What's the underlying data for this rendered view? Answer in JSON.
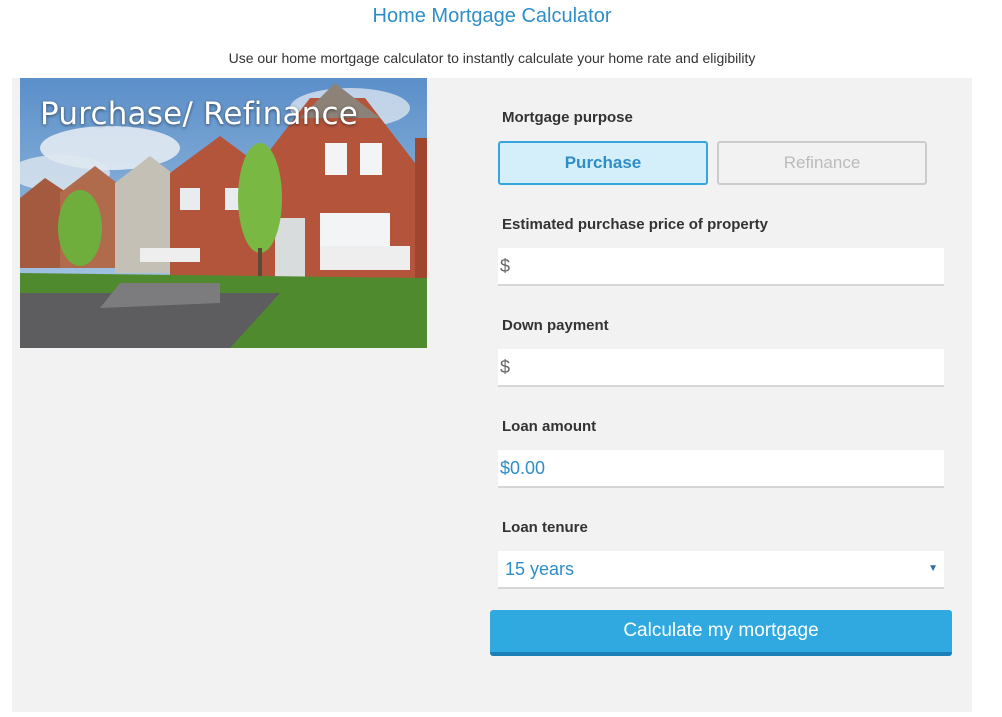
{
  "header": {
    "title": "Home Mortgage Calculator",
    "subtitle": "Use our home mortgage calculator to instantly calculate your home rate and eligibility"
  },
  "hero": {
    "caption": "Purchase/ Refinance"
  },
  "form": {
    "purpose_label": "Mortgage purpose",
    "purpose_options": [
      "Purchase",
      "Refinance"
    ],
    "purpose_selected": "Purchase",
    "price_label": "Estimated purchase price of property",
    "price_prefix": "$",
    "price_value": "",
    "down_label": "Down payment",
    "down_prefix": "$",
    "down_value": "",
    "loan_label": "Loan amount",
    "loan_value": "$0.00",
    "tenure_label": "Loan tenure",
    "tenure_value": "15 years",
    "tenure_arrow": "▼",
    "submit_label": "Calculate my mortgage"
  },
  "colors": {
    "accent": "#2fa9e0",
    "title_blue": "#2e8ec8",
    "panel_bg": "#f2f2f2"
  }
}
